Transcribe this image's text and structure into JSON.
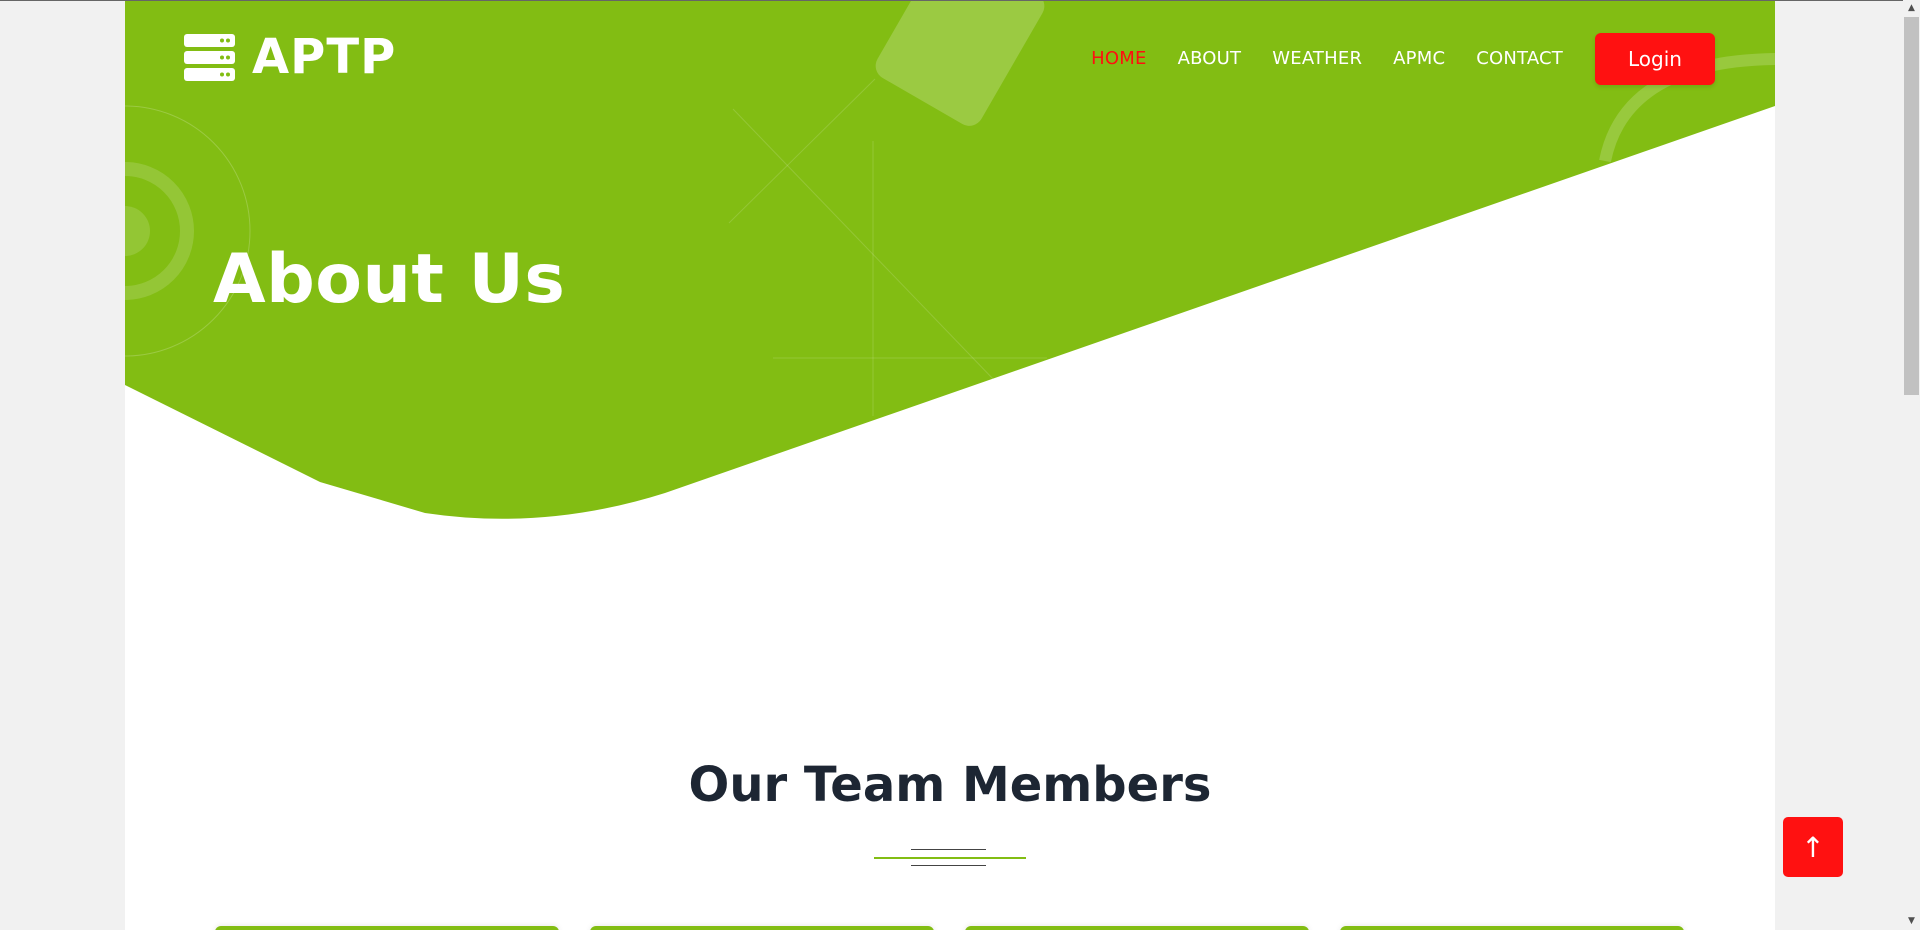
{
  "brand": {
    "name": "APTP"
  },
  "nav": {
    "items": [
      {
        "label": "HOME",
        "active": true
      },
      {
        "label": "ABOUT",
        "active": false
      },
      {
        "label": "WEATHER",
        "active": false
      },
      {
        "label": "APMC",
        "active": false
      },
      {
        "label": "CONTACT",
        "active": false
      }
    ],
    "login_label": "Login"
  },
  "hero": {
    "title": "About Us"
  },
  "team": {
    "title": "Our Team Members",
    "card_count": 4
  },
  "scroll_top": {
    "icon": "arrow-up-icon",
    "glyph": "↑"
  },
  "colors": {
    "brand_green": "#82bd13",
    "accent_red": "#ff1111",
    "heading_dark": "#1d2633"
  }
}
